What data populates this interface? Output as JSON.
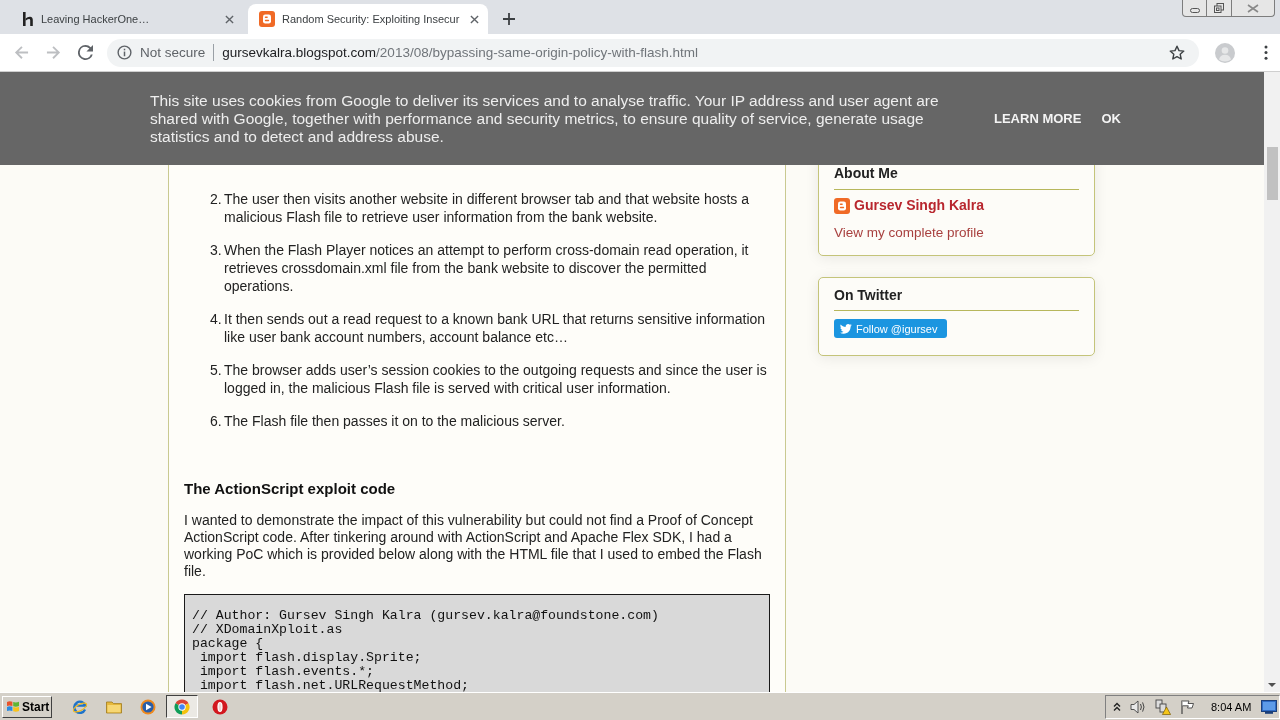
{
  "browser": {
    "tabs": [
      {
        "kind": "letter-h",
        "title": "Leaving HackerOne…",
        "selected": false
      },
      {
        "kind": "blog",
        "title": "Random Security: Exploiting Insecur",
        "selected": true
      }
    ],
    "toolbar": {
      "back": {
        "disabled": true
      },
      "forward": {
        "disabled": true
      },
      "security_label": "Not secure",
      "url_host": "gursevkalra.blogspot.com",
      "url_path": "/2013/08/bypassing-same-origin-policy-with-flash.html"
    }
  },
  "cookie_banner": {
    "text": "This site uses cookies from Google to deliver its services and to analyse traffic. Your IP address and user agent are shared with Google, together with performance and security metrics, to ensure quality of service, generate usage statistics and to detect and address abuse.",
    "actions": [
      "LEARN MORE",
      "OK"
    ]
  },
  "article": {
    "steps": [
      {
        "number": "2.",
        "text": "The user then visits another website in different browser tab and that website hosts a malicious Flash file to retrieve user information from the bank website."
      },
      {
        "number": "3.",
        "text": "When the Flash Player notices an attempt to perform cross-domain read operation, it retrieves crossdomain.xml file from the bank website to discover the permitted operations."
      },
      {
        "number": "4.",
        "text": "It then sends out a read request to a known bank URL that returns sensitive information like user bank account numbers, account balance etc…"
      },
      {
        "number": "5.",
        "text": "The browser adds user’s session cookies to the outgoing requests and since the user is logged in, the malicious Flash file is served with critical user information."
      },
      {
        "number": "6.",
        "text": "The Flash file then passes it on to the malicious server."
      }
    ],
    "heading": "The ActionScript exploit code",
    "paragraph": "I wanted to demonstrate the impact of this vulnerability but could not find a Proof of Concept ActionScript code. After tinkering around with ActionScript and Apache Flex SDK, I had a working PoC which is provided below along with the HTML file that I used to embed the Flash file.",
    "code_lines": [
      "// Author: Gursev Singh Kalra (gursev.kalra@foundstone.com)",
      "// XDomainXploit.as",
      "package {",
      " import flash.display.Sprite;",
      " import flash.events.*;",
      " import flash.net.URLRequestMethod;"
    ]
  },
  "sidebar": {
    "about_me": {
      "title": "About Me",
      "name": "Gursev Singh Kalra",
      "profile_link": "View my complete profile"
    },
    "twitter": {
      "title": "On Twitter",
      "follow_button": "Follow @igursev"
    }
  },
  "taskbar": {
    "start": "Start",
    "windows": [
      {
        "kind": "round-browser",
        "selected": true
      },
      {
        "kind": "red-o",
        "selected": false
      }
    ],
    "clock": "8:04 AM"
  }
}
